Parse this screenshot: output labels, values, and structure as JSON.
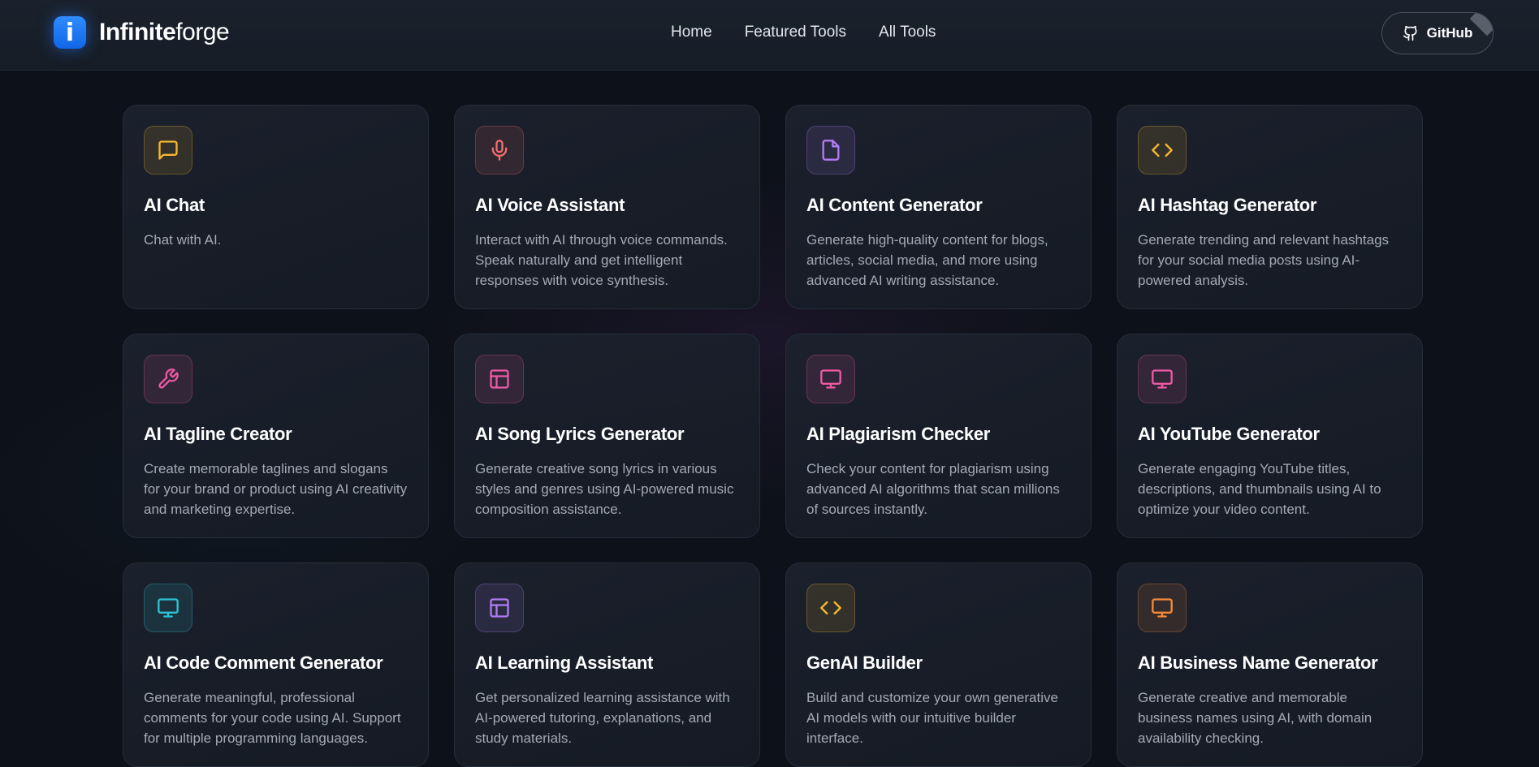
{
  "brand": {
    "bold": "Infinite",
    "light": "forge",
    "badge": "i"
  },
  "nav": [
    {
      "label": "Home"
    },
    {
      "label": "Featured Tools"
    },
    {
      "label": "All Tools"
    }
  ],
  "github": {
    "label": "GitHub"
  },
  "colors": {
    "yellow": "#f5b82e",
    "red": "#f26d6d",
    "purple": "#b07cf2",
    "pink": "#ec5aa4",
    "cyan": "#2ec4d6",
    "orange": "#f58a3a"
  },
  "cards": [
    {
      "title": "AI Chat",
      "desc": "Chat with AI.",
      "icon": "chat-icon",
      "color": "yellow"
    },
    {
      "title": "AI Voice Assistant",
      "desc": "Interact with AI through voice commands. Speak naturally and get intelligent responses with voice synthesis.",
      "icon": "microphone-icon",
      "color": "red"
    },
    {
      "title": "AI Content Generator",
      "desc": "Generate high-quality content for blogs, articles, social media, and more using advanced AI writing assistance.",
      "icon": "file-icon",
      "color": "purple"
    },
    {
      "title": "AI Hashtag Generator",
      "desc": "Generate trending and relevant hashtags for your social media posts using AI-powered analysis.",
      "icon": "code-icon",
      "color": "yellow"
    },
    {
      "title": "AI Tagline Creator",
      "desc": "Create memorable taglines and slogans for your brand or product using AI creativity and marketing expertise.",
      "icon": "wrench-icon",
      "color": "pink"
    },
    {
      "title": "AI Song Lyrics Generator",
      "desc": "Generate creative song lyrics in various styles and genres using AI-powered music composition assistance.",
      "icon": "layout-icon",
      "color": "pink"
    },
    {
      "title": "AI Plagiarism Checker",
      "desc": "Check your content for plagiarism using advanced AI algorithms that scan millions of sources instantly.",
      "icon": "monitor-icon",
      "color": "pink"
    },
    {
      "title": "AI YouTube Generator",
      "desc": "Generate engaging YouTube titles, descriptions, and thumbnails using AI to optimize your video content.",
      "icon": "monitor-icon",
      "color": "pink"
    },
    {
      "title": "AI Code Comment Generator",
      "desc": "Generate meaningful, professional comments for your code using AI. Support for multiple programming languages.",
      "icon": "monitor-icon",
      "color": "cyan"
    },
    {
      "title": "AI Learning Assistant",
      "desc": "Get personalized learning assistance with AI-powered tutoring, explanations, and study materials.",
      "icon": "layout-icon",
      "color": "purple"
    },
    {
      "title": "GenAI Builder",
      "desc": "Build and customize your own generative AI models with our intuitive builder interface.",
      "icon": "code-icon",
      "color": "yellow"
    },
    {
      "title": "AI Business Name Generator",
      "desc": "Generate creative and memorable business names using AI, with domain availability checking.",
      "icon": "monitor-icon",
      "color": "orange"
    }
  ]
}
